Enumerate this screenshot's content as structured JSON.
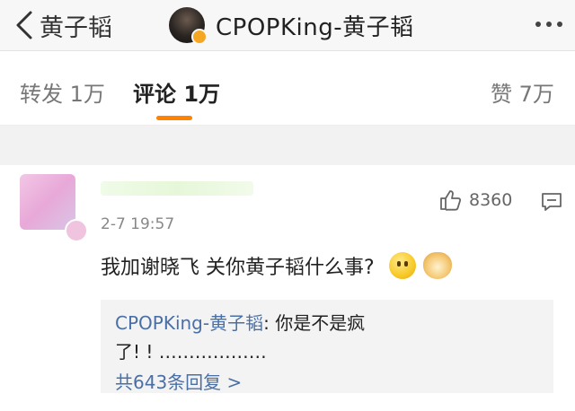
{
  "header": {
    "back_label": "黄子韬",
    "title": "CPOPKing-黄子韬"
  },
  "tabs": [
    {
      "label": "转发 1万"
    },
    {
      "label": "评论 1万"
    },
    {
      "label": "赞 7万"
    }
  ],
  "comment": {
    "time": "2-7 19:57",
    "like_count": "8360",
    "text": "我加谢晓飞 关你黄子韬什么事?",
    "reply": {
      "user": "CPOPKing-黄子韬",
      "text_line1": ": 你是不是疯",
      "text_line2": "了! ! ………………",
      "more_label": "共643条回复 >"
    }
  },
  "colors": {
    "accent": "#ff8200",
    "link": "#4a6fa5"
  }
}
